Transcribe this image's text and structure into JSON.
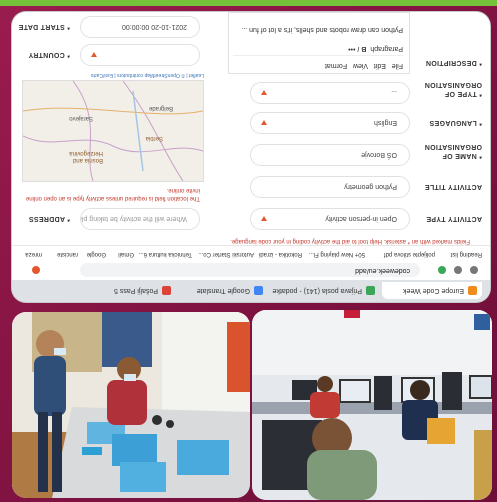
{
  "tabs": [
    {
      "label": "Europe Code Week",
      "color": "#f08c1e"
    },
    {
      "label": "Prijava posla (141) - podatke",
      "color": "#3aa657"
    },
    {
      "label": "Google Translate",
      "color": "#4285f4"
    },
    {
      "label": "Pošalji Pass 5",
      "color": "#db4437"
    }
  ],
  "address_bar": {
    "url": "codeweek.eu/add"
  },
  "bookmarks": [
    "Reading list",
    "polijepte stilova pdf",
    "50+ New playing Fl...",
    "Rokotika - izradi",
    "Autorski Starter Co...",
    "Tehnicka kultura 6...",
    "Gmail",
    "Google",
    "ranciste",
    "mreza"
  ],
  "notice": "Fields marked with an * asterisk. Help tool to aid the activity coding in your code language.",
  "form": {
    "activity_type": {
      "label": "ACTIVITY TYPE",
      "value": "Open in-person activity"
    },
    "activity_title": {
      "label": "ACTIVITY TITLE",
      "value": "Python geometry"
    },
    "organisation_name": {
      "label": "* NAME OF ORGANISATION",
      "value": "OŠ Borovje"
    },
    "languages": {
      "label": "* LANGUAGES",
      "value": "English"
    },
    "organisation_type": {
      "label": "* TYPE OF ORGANISATION",
      "value": "..."
    },
    "description": {
      "label": "* DESCRIPTION",
      "menu": [
        "File",
        "Edit",
        "View",
        "Format"
      ],
      "paragraph": "Paragraph",
      "text": "Python can draw robots and shells, it's a lot of fun ..."
    },
    "address": {
      "label": "* ADDRESS",
      "placeholder": "Where will the activity be taking place?"
    },
    "location_hint": "The location field is required unless activity type is an open online invite online.",
    "map_credit": "Leaflet | © OpenStreetMap contributors | Esri/Carto",
    "map_labels": [
      "Serbia",
      "Bosnia and Herzegovina",
      "Sarajevo",
      "Belgrade"
    ],
    "country": {
      "label": "* COUNTRY",
      "value": ""
    },
    "start_date": {
      "label": "* START DATE",
      "value": "2021-10-20 00:00:00"
    }
  },
  "colors": {
    "frame": "#8c1846",
    "accent": "#e4572e",
    "band": "#73c23a"
  }
}
